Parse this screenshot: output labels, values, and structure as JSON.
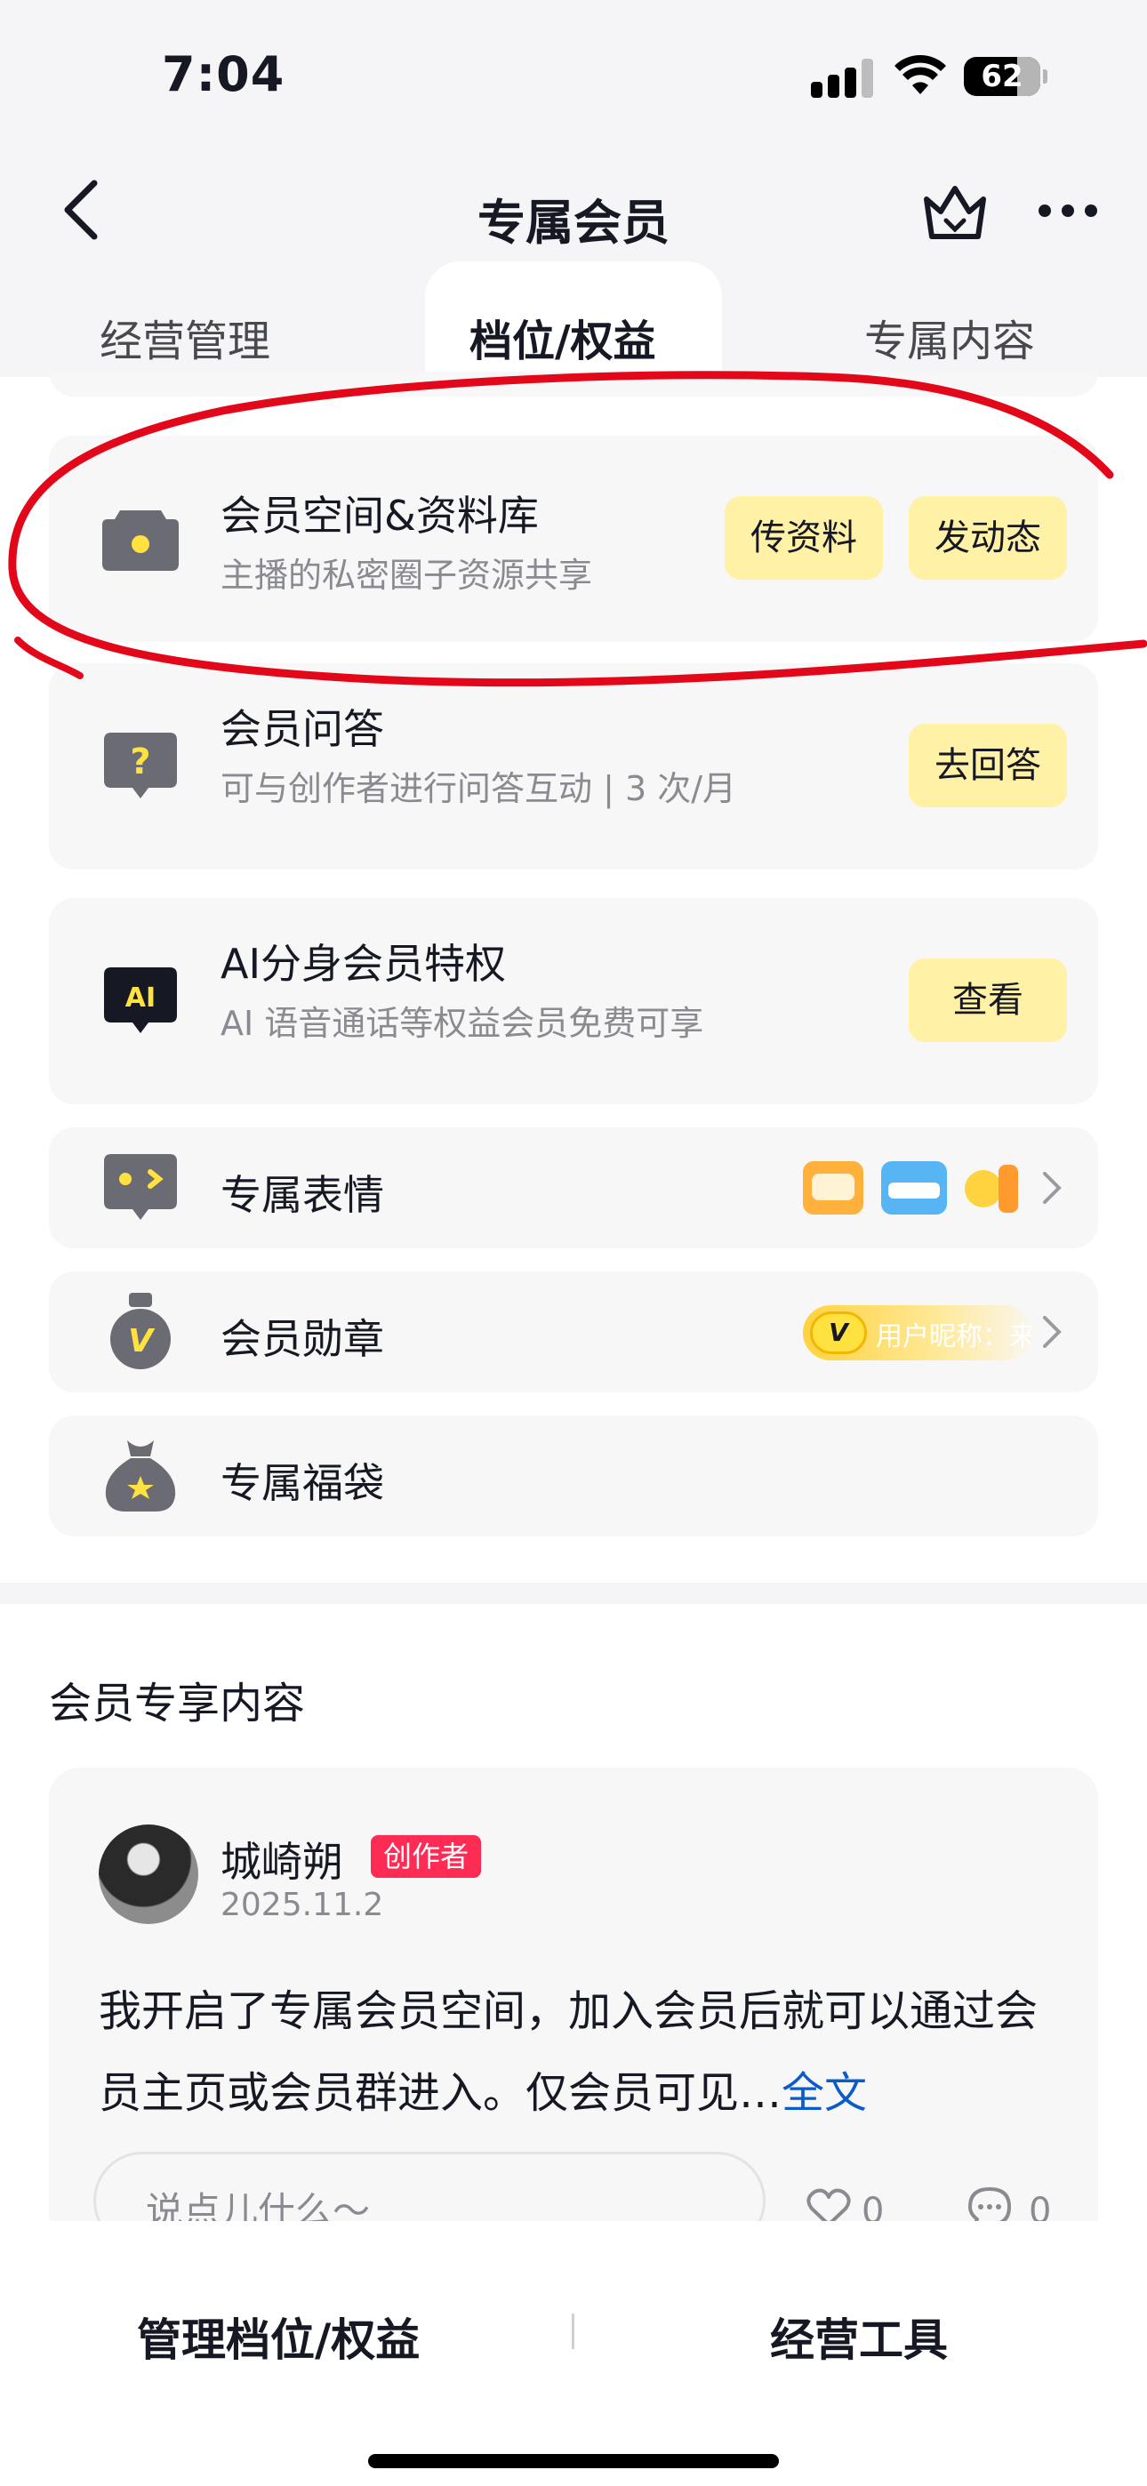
{
  "status_bar": {
    "time": "7:04",
    "battery": "62"
  },
  "nav": {
    "title": "专属会员"
  },
  "tabs": [
    {
      "label": "经营管理",
      "active": false
    },
    {
      "label": "档位/权益",
      "active": true
    },
    {
      "label": "专属内容",
      "active": false
    }
  ],
  "benefits": [
    {
      "title": "会员空间&资料库",
      "subtitle": "主播的私密圈子资源共享",
      "icon": "camera-icon",
      "actions": [
        "传资料",
        "发动态"
      ]
    },
    {
      "title": "会员问答",
      "subtitle": "可与创作者进行问答互动 | 3 次/月",
      "icon": "question-bubble-icon",
      "actions": [
        "去回答"
      ]
    },
    {
      "title": "AI分身会员特权",
      "subtitle": "AI 语音通话等权益会员免费可享",
      "icon": "ai-bubble-icon",
      "actions": [
        "查看"
      ]
    },
    {
      "title": "专属表情",
      "icon": "emoji-bubble-icon",
      "stickers": [
        "sticker-1-icon",
        "sticker-cool-icon",
        "sticker-laugh-icon"
      ]
    },
    {
      "title": "会员勋章",
      "icon": "medal-icon",
      "badge_preview": {
        "letter": "V",
        "text": "用户昵称：来"
      }
    },
    {
      "title": "专属福袋",
      "icon": "lucky-bag-icon"
    }
  ],
  "members_section": {
    "title": "会员专享内容",
    "post": {
      "author": "城崎朔",
      "badge": "创作者",
      "date": "2025.11.2",
      "text": "我开启了专属会员空间，加入会员后就可以通过会员主页或会员群进入。仅会员可见…",
      "more_link": "全文",
      "comment_placeholder": "说点儿什么～",
      "likes": "0",
      "comments": "0"
    }
  },
  "bottom_bar": {
    "manage": "管理档位/权益",
    "tools": "经营工具"
  },
  "colors": {
    "accent_yellow": "#fff1a6",
    "badge_red": "#fe2c55",
    "annotation_red": "#e3071a",
    "link_blue": "#0b5cc8"
  }
}
